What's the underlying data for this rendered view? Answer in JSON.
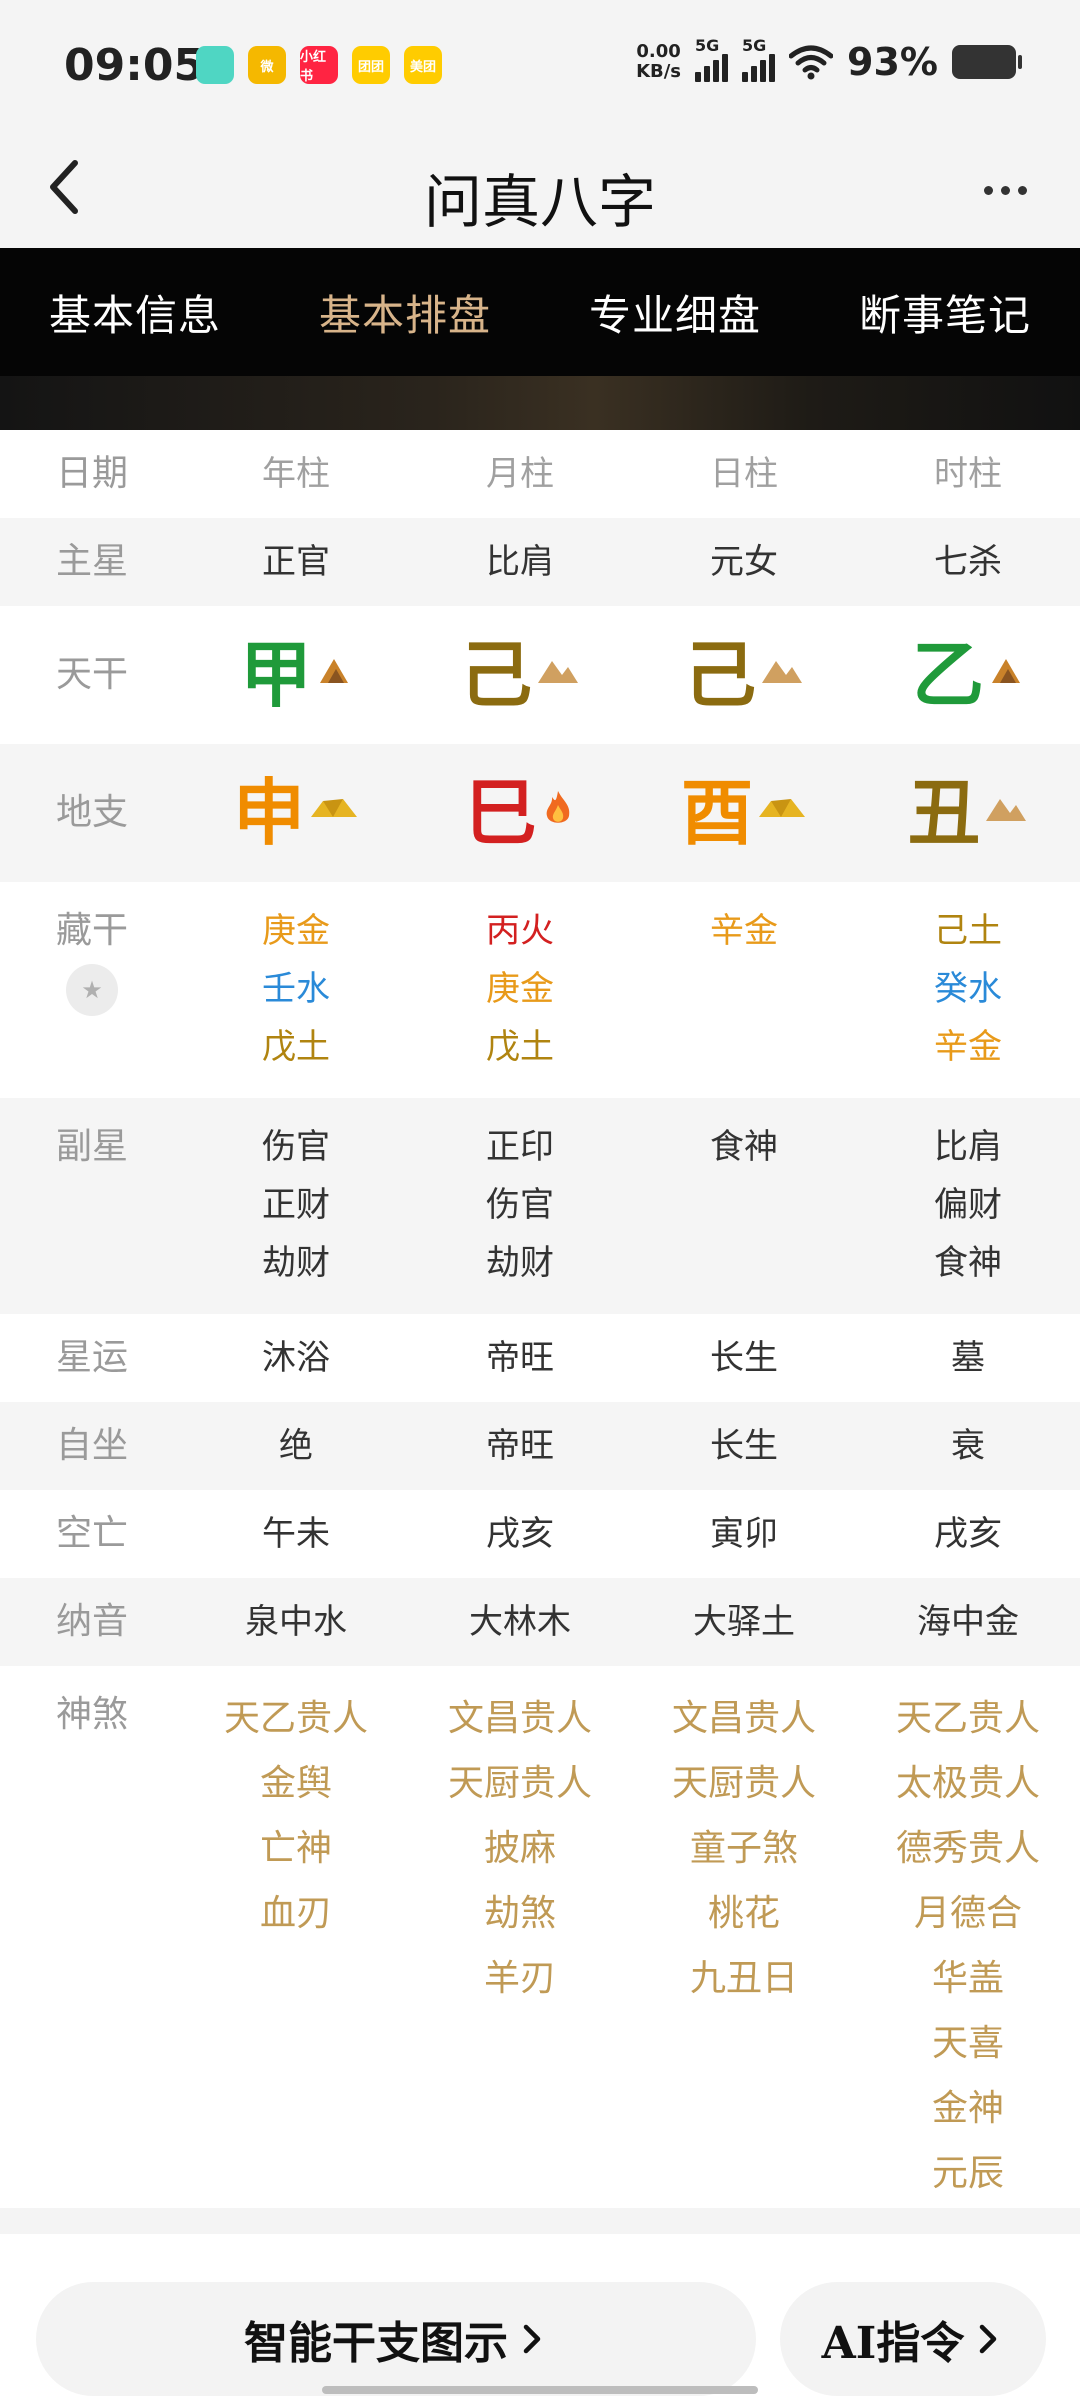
{
  "status_bar": {
    "time": "09:05",
    "apps": [
      {
        "name": "chat-app-icon",
        "label": "",
        "color": "#4fd6c3"
      },
      {
        "name": "weibo-icon",
        "label": "微",
        "color": "#f5b800"
      },
      {
        "name": "xiaohongshu-icon",
        "label": "小红书",
        "color": "#ff2442"
      },
      {
        "name": "tuantuan-icon",
        "label": "团团",
        "color": "#ffcc00"
      },
      {
        "name": "meituan-icon",
        "label": "美团",
        "color": "#ffcc00"
      }
    ],
    "net_speed": "0.00",
    "net_unit": "KB/s",
    "sig1": "5G",
    "sig2": "5G",
    "battery": "93%"
  },
  "header": {
    "title": "问真八字"
  },
  "tabs": [
    {
      "label": "基本信息",
      "active": false
    },
    {
      "label": "基本排盘",
      "active": true
    },
    {
      "label": "专业细盘",
      "active": false
    },
    {
      "label": "断事笔记",
      "active": false
    }
  ],
  "table": {
    "header": {
      "label": "日期",
      "cols": [
        "年柱",
        "月柱",
        "日柱",
        "时柱"
      ]
    },
    "zhuxing": {
      "label": "主星",
      "cols": [
        "正官",
        "比肩",
        "元女",
        "七杀"
      ]
    },
    "tiangan": {
      "label": "天干",
      "cols": [
        {
          "char": "甲",
          "color": "#1f9a3a",
          "icon": "wood-icon"
        },
        {
          "char": "己",
          "color": "#8b6b10",
          "icon": "earth-icon"
        },
        {
          "char": "己",
          "color": "#8b6b10",
          "icon": "earth-icon"
        },
        {
          "char": "乙",
          "color": "#1f9a3a",
          "icon": "wood-icon"
        }
      ]
    },
    "dizhi": {
      "label": "地支",
      "cols": [
        {
          "char": "申",
          "color": "#f08c00",
          "icon": "metal-icon"
        },
        {
          "char": "巳",
          "color": "#d32020",
          "icon": "fire-icon"
        },
        {
          "char": "酉",
          "color": "#f08c00",
          "icon": "metal-icon"
        },
        {
          "char": "丑",
          "color": "#8b6b10",
          "icon": "earth-icon"
        }
      ]
    },
    "canggan": {
      "label": "藏干",
      "cols": [
        [
          {
            "t": "庚金",
            "c": "#e89a1a"
          },
          {
            "t": "壬水",
            "c": "#2a8ad8"
          },
          {
            "t": "戊土",
            "c": "#b08410"
          }
        ],
        [
          {
            "t": "丙火",
            "c": "#d32020"
          },
          {
            "t": "庚金",
            "c": "#e89a1a"
          },
          {
            "t": "戊土",
            "c": "#b08410"
          }
        ],
        [
          {
            "t": "辛金",
            "c": "#e89a1a"
          }
        ],
        [
          {
            "t": "己土",
            "c": "#b08410"
          },
          {
            "t": "癸水",
            "c": "#2a8ad8"
          },
          {
            "t": "辛金",
            "c": "#e89a1a"
          }
        ]
      ]
    },
    "fuxing": {
      "label": "副星",
      "cols": [
        [
          "伤官",
          "正财",
          "劫财"
        ],
        [
          "正印",
          "伤官",
          "劫财"
        ],
        [
          "食神"
        ],
        [
          "比肩",
          "偏财",
          "食神"
        ]
      ]
    },
    "xingyun": {
      "label": "星运",
      "cols": [
        "沐浴",
        "帝旺",
        "长生",
        "墓"
      ]
    },
    "zizuo": {
      "label": "自坐",
      "cols": [
        "绝",
        "帝旺",
        "长生",
        "衰"
      ]
    },
    "kongwang": {
      "label": "空亡",
      "cols": [
        "午未",
        "戌亥",
        "寅卯",
        "戌亥"
      ]
    },
    "nayin": {
      "label": "纳音",
      "cols": [
        "泉中水",
        "大林木",
        "大驿土",
        "海中金"
      ]
    },
    "shensha": {
      "label": "神煞",
      "cols": [
        [
          "天乙贵人",
          "金舆",
          "亡神",
          "血刃"
        ],
        [
          "文昌贵人",
          "天厨贵人",
          "披麻",
          "劫煞",
          "羊刃"
        ],
        [
          "文昌贵人",
          "天厨贵人",
          "童子煞",
          "桃花",
          "九丑日"
        ],
        [
          "天乙贵人",
          "太极贵人",
          "德秀贵人",
          "月德合",
          "华盖",
          "天喜",
          "金神",
          "元辰"
        ]
      ]
    }
  },
  "bottom": {
    "button1": "智能干支图示",
    "button2": "AI指令"
  }
}
